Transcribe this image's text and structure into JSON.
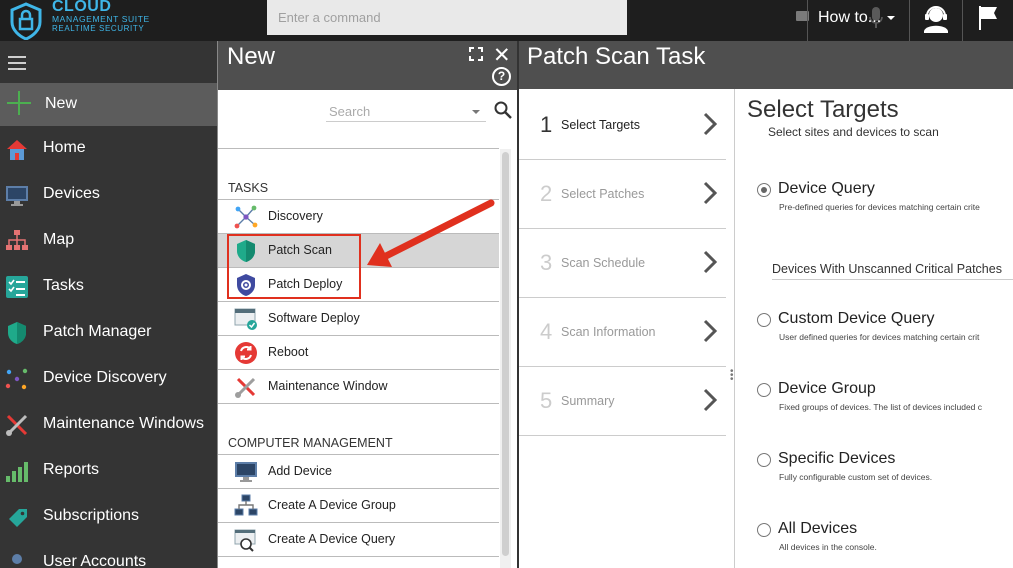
{
  "topbar": {
    "logo_line1": "CLOUD",
    "logo_line2": "MANAGEMENT SUITE",
    "logo_line3": "REALTIME SECURITY",
    "command_placeholder": "Enter a command",
    "howto_label": "How to..."
  },
  "leftnav": {
    "items": [
      {
        "label": "New",
        "icon": "plus-icon"
      },
      {
        "label": "Home",
        "icon": "home-icon"
      },
      {
        "label": "Devices",
        "icon": "monitor-icon"
      },
      {
        "label": "Map",
        "icon": "network-map-icon"
      },
      {
        "label": "Tasks",
        "icon": "tasks-icon"
      },
      {
        "label": "Patch Manager",
        "icon": "shield-icon"
      },
      {
        "label": "Device Discovery",
        "icon": "discovery-icon"
      },
      {
        "label": "Maintenance Windows",
        "icon": "tools-icon"
      },
      {
        "label": "Reports",
        "icon": "reports-icon"
      },
      {
        "label": "Subscriptions",
        "icon": "subscriptions-icon"
      },
      {
        "label": "User Accounts",
        "icon": "user-icon"
      }
    ],
    "accent": "#4caf50"
  },
  "newpanel": {
    "title": "New",
    "search_placeholder": "Search",
    "sections": [
      {
        "title": "TASKS",
        "items": [
          {
            "label": "Discovery",
            "icon": "discovery-icon"
          },
          {
            "label": "Patch Scan",
            "icon": "patch-shield-icon"
          },
          {
            "label": "Patch Deploy",
            "icon": "patch-deploy-icon"
          },
          {
            "label": "Software Deploy",
            "icon": "software-deploy-icon"
          },
          {
            "label": "Reboot",
            "icon": "reboot-icon"
          },
          {
            "label": "Maintenance Window",
            "icon": "tools-icon"
          }
        ]
      },
      {
        "title": "COMPUTER MANAGEMENT",
        "items": [
          {
            "label": "Add Device",
            "icon": "monitor-icon"
          },
          {
            "label": "Create A Device Group",
            "icon": "device-group-icon"
          },
          {
            "label": "Create A Device Query",
            "icon": "device-query-icon"
          }
        ]
      }
    ],
    "highlight_color": "#e0301e"
  },
  "wizard": {
    "title": "Patch Scan Task",
    "steps": [
      {
        "num": "1",
        "label": "Select Targets"
      },
      {
        "num": "2",
        "label": "Select Patches"
      },
      {
        "num": "3",
        "label": "Scan Schedule"
      },
      {
        "num": "4",
        "label": "Scan Information"
      },
      {
        "num": "5",
        "label": "Summary"
      }
    ],
    "section_title": "Select Targets",
    "section_subtitle": "Select sites and devices to scan",
    "options": [
      {
        "label": "Device Query",
        "desc": "Pre-defined queries for devices matching certain crite"
      },
      {
        "label": "Custom Device Query",
        "desc": "User defined queries for devices matching certain crit"
      },
      {
        "label": "Device Group",
        "desc": "Fixed groups of devices. The list of devices included c"
      },
      {
        "label": "Specific Devices",
        "desc": "Fully configurable custom set of devices."
      },
      {
        "label": "All Devices",
        "desc": "All devices in the console."
      }
    ],
    "selected_option": "Device Query",
    "device_query_value": "Devices With Unscanned Critical Patches"
  }
}
